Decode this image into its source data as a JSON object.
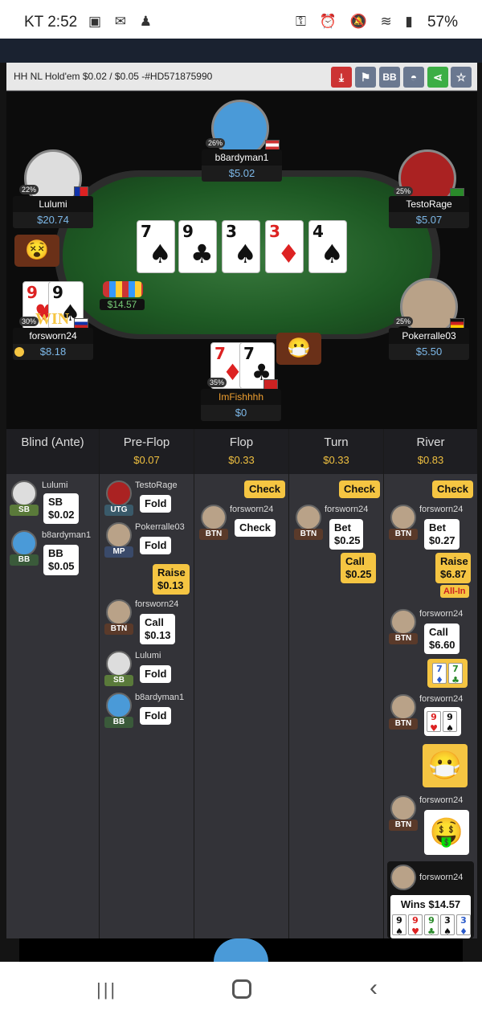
{
  "status": {
    "carrier": "KT",
    "time": "2:52",
    "battery": "57%"
  },
  "title": "HH NL Hold'em $0.02 / $0.05 -#HD571875990",
  "board": [
    {
      "rank": "7",
      "suit": "♠",
      "color": "black"
    },
    {
      "rank": "9",
      "suit": "♣",
      "color": "black"
    },
    {
      "rank": "3",
      "suit": "♠",
      "color": "black"
    },
    {
      "rank": "3",
      "suit": "♦",
      "color": "red"
    },
    {
      "rank": "4",
      "suit": "♠",
      "color": "black"
    }
  ],
  "pot": "$14.57",
  "players": {
    "b8ardyman1": {
      "name": "b8ardyman1",
      "stack": "$5.02",
      "pct": "26%"
    },
    "lulumi": {
      "name": "Lulumi",
      "stack": "$20.74",
      "pct": "22%"
    },
    "testorage": {
      "name": "TestoRage",
      "stack": "$5.07",
      "pct": "25%"
    },
    "forsworn24": {
      "name": "forsworn24",
      "stack": "$8.18",
      "pct": "30%",
      "win": "WIN"
    },
    "pokerralle03": {
      "name": "Pokerralle03",
      "stack": "$5.50",
      "pct": "25%"
    },
    "imfishhhh": {
      "name": "ImFishhhh",
      "stack": "$0",
      "pct": "35%"
    }
  },
  "forsworn_cards": [
    {
      "rank": "9",
      "suit": "♥",
      "color": "red"
    },
    {
      "rank": "9",
      "suit": "♠",
      "color": "black"
    }
  ],
  "hero_cards": [
    {
      "rank": "7",
      "suit": "♦",
      "color": "red"
    },
    {
      "rank": "7",
      "suit": "♣",
      "color": "black"
    }
  ],
  "columns": [
    {
      "name": "Blind (Ante)",
      "pot": ""
    },
    {
      "name": "Pre-Flop",
      "pot": "$0.07"
    },
    {
      "name": "Flop",
      "pot": "$0.33"
    },
    {
      "name": "Turn",
      "pot": "$0.33"
    },
    {
      "name": "River",
      "pot": "$0.83"
    }
  ],
  "positions": {
    "sb": "SB",
    "bb": "BB",
    "utg": "UTG",
    "mp": "MP",
    "btn": "BTN"
  },
  "actions": {
    "sb": "SB $0.02",
    "bb": "BB $0.05",
    "fold": "Fold",
    "raise1": "Raise $0.13",
    "call1": "Call $0.13",
    "check": "Check",
    "bet1": "Bet $0.25",
    "call2": "Call $0.25",
    "bet2": "Bet $0.27",
    "raise2": "Raise $6.87",
    "allin": "All-In",
    "call3": "Call $6.60",
    "wins": "Wins $14.57"
  },
  "mini_77": [
    {
      "rank": "7",
      "suit": "♦",
      "color": "blue"
    },
    {
      "rank": "7",
      "suit": "♣",
      "color": "green"
    }
  ],
  "mini_99": [
    {
      "rank": "9",
      "suit": "♥",
      "color": "red"
    },
    {
      "rank": "9",
      "suit": "♠",
      "color": "black"
    }
  ],
  "wins_cards": [
    {
      "rank": "9",
      "suit": "♠",
      "color": "black"
    },
    {
      "rank": "9",
      "suit": "♥",
      "color": "red"
    },
    {
      "rank": "9",
      "suit": "♣",
      "color": "green"
    },
    {
      "rank": "3",
      "suit": "♠",
      "color": "black"
    },
    {
      "rank": "3",
      "suit": "♦",
      "color": "blue"
    }
  ]
}
